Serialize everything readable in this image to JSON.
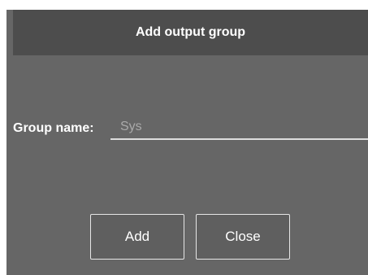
{
  "dialog": {
    "title": "Add output group",
    "group_name_label": "Group name:",
    "group_name_value": "",
    "group_name_placeholder": "Sys",
    "add_label": "Add",
    "close_label": "Close"
  },
  "colors": {
    "dialog_bg": "#666666",
    "titlebar_bg": "#4d4d4d",
    "text": "#ffffff",
    "placeholder": "#aaaaaa",
    "underline": "#dddddd"
  }
}
